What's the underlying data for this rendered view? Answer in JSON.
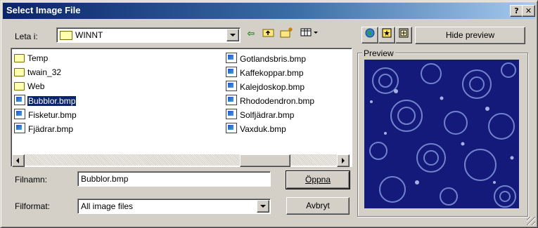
{
  "window": {
    "title": "Select Image File",
    "help_btn": "?",
    "close_btn": "✕"
  },
  "look_in": {
    "label": "Leta i:",
    "value": "WINNT"
  },
  "toolbar_icons": [
    "back-arrow-icon",
    "up-folder-icon",
    "new-folder-icon",
    "view-menu-icon"
  ],
  "preview_tools": {
    "icons": [
      "globe-icon",
      "scan-icon",
      "acquire-icon"
    ],
    "hide_preview_label": "Hide preview"
  },
  "files": {
    "col1": [
      {
        "name": "Temp",
        "type": "folder"
      },
      {
        "name": "twain_32",
        "type": "folder"
      },
      {
        "name": "Web",
        "type": "folder"
      },
      {
        "name": "Bubblor.bmp",
        "type": "bmp",
        "selected": true
      },
      {
        "name": "Fisketur.bmp",
        "type": "bmp"
      },
      {
        "name": "Fjädrar.bmp",
        "type": "bmp"
      }
    ],
    "col2": [
      {
        "name": "Gotlandsbris.bmp",
        "type": "bmp"
      },
      {
        "name": "Kaffekoppar.bmp",
        "type": "bmp"
      },
      {
        "name": "Kalejdoskop.bmp",
        "type": "bmp"
      },
      {
        "name": "Rhododendron.bmp",
        "type": "bmp"
      },
      {
        "name": "Solfjädrar.bmp",
        "type": "bmp"
      },
      {
        "name": "Vaxduk.bmp",
        "type": "bmp"
      }
    ]
  },
  "filename": {
    "label": "Filnamn:",
    "value": "Bubblor.bmp"
  },
  "filetype": {
    "label": "Filformat:",
    "value": "All image files"
  },
  "buttons": {
    "open": "Öppna",
    "cancel": "Avbryt"
  },
  "preview": {
    "legend": "Preview",
    "bg_color": "#141a7a"
  }
}
